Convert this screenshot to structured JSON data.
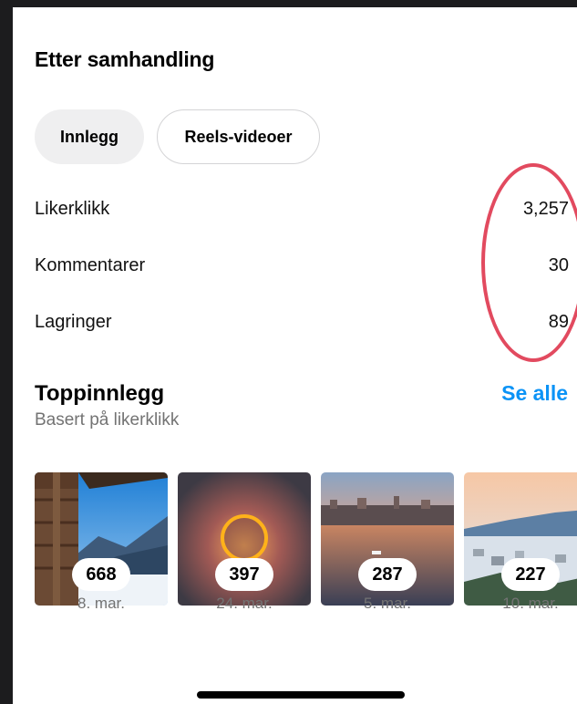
{
  "section": {
    "title": "Etter samhandling"
  },
  "tabs": [
    {
      "label": "Innlegg",
      "active": true
    },
    {
      "label": "Reels-videoer",
      "active": false
    }
  ],
  "metrics": [
    {
      "label": "Likerklikk",
      "value": "3,257"
    },
    {
      "label": "Kommentarer",
      "value": "30"
    },
    {
      "label": "Lagringer",
      "value": "89"
    }
  ],
  "top_posts": {
    "title": "Toppinnlegg",
    "subtitle": "Basert på likerklikk",
    "see_all": "Se alle",
    "items": [
      {
        "count": "668",
        "date": "8. mar."
      },
      {
        "count": "397",
        "date": "24. mar."
      },
      {
        "count": "287",
        "date": "5. mar."
      },
      {
        "count": "227",
        "date": "10. mar."
      }
    ]
  },
  "colors": {
    "accent": "#0b93f6",
    "annotation_ring": "#e24a5f",
    "active_tab_bg": "#efeff0"
  }
}
